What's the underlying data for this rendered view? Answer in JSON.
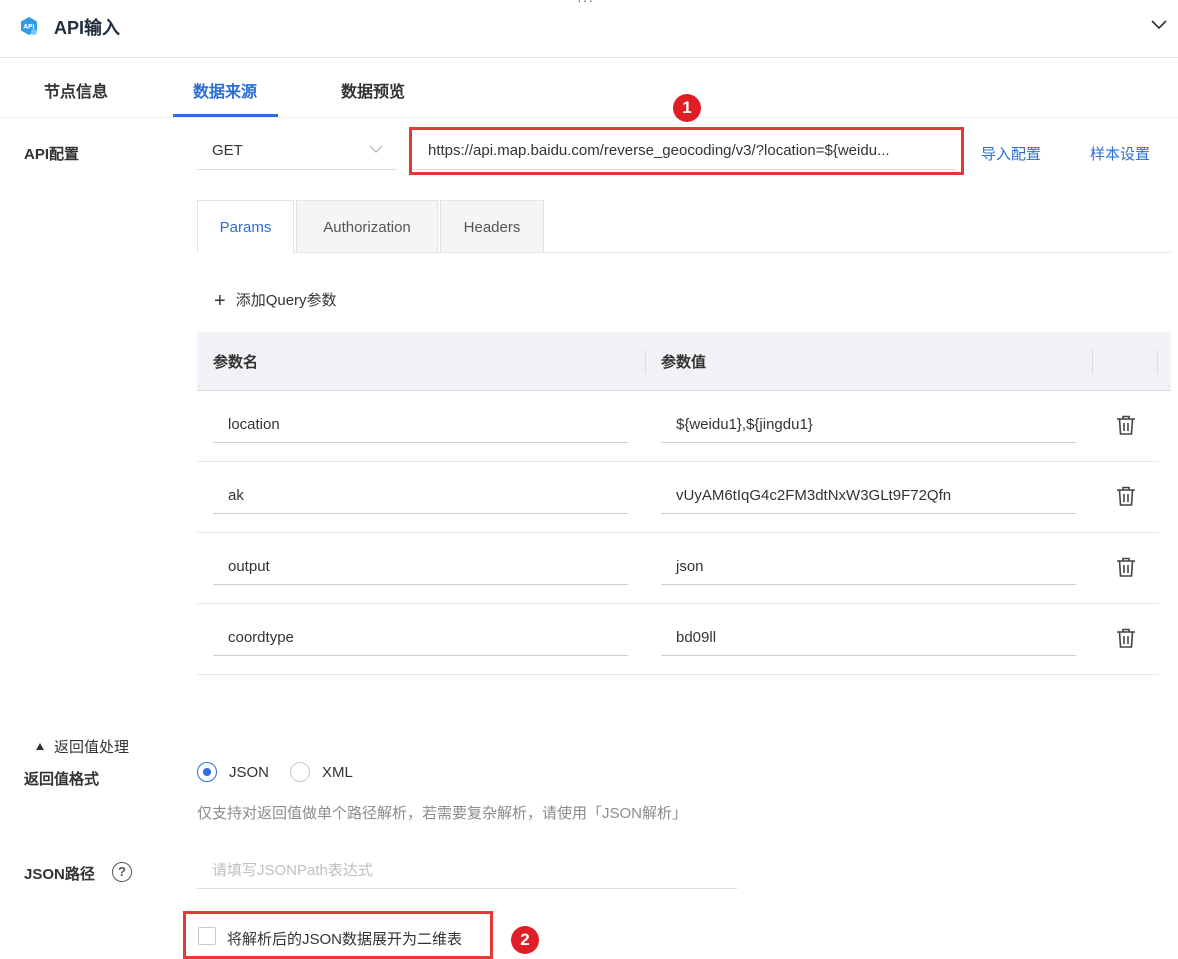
{
  "header": {
    "dots": "···",
    "title": "API输入"
  },
  "tabs": [
    {
      "label": "节点信息"
    },
    {
      "label": "数据来源"
    },
    {
      "label": "数据预览"
    }
  ],
  "api_config": {
    "label": "API配置",
    "method": "GET",
    "url": "https://api.map.baidu.com/reverse_geocoding/v3/?location=${weidu...",
    "import_link": "导入配置",
    "sample_link": "样本设置"
  },
  "subtabs": [
    {
      "label": "Params"
    },
    {
      "label": "Authorization"
    },
    {
      "label": "Headers"
    }
  ],
  "params": {
    "add_label": "添加Query参数",
    "col_name": "参数名",
    "col_value": "参数值",
    "rows": [
      {
        "name": "location",
        "value": "${weidu1},${jingdu1}"
      },
      {
        "name": "ak",
        "value": "vUyAM6tIqG4c2FM3dtNxW3GLt9F72Qfn"
      },
      {
        "name": "output",
        "value": "json"
      },
      {
        "name": "coordtype",
        "value": "bd09ll"
      }
    ]
  },
  "return_section": {
    "toggle_label": "返回值处理",
    "format_label": "返回值格式",
    "options": [
      {
        "label": "JSON",
        "checked": true
      },
      {
        "label": "XML",
        "checked": false
      }
    ],
    "hint": "仅支持对返回值做单个路径解析，若需要复杂解析，请使用「JSON解析」",
    "json_path_label": "JSON路径",
    "json_path_placeholder": "请填写JSONPath表达式",
    "json_path_value": "",
    "flatten_label": "将解析后的JSON数据展开为二维表",
    "flatten_checked": false
  },
  "badges": {
    "first": "1",
    "second": "2"
  },
  "colors": {
    "accent": "#2c6ed8",
    "highlight": "#e53935"
  }
}
